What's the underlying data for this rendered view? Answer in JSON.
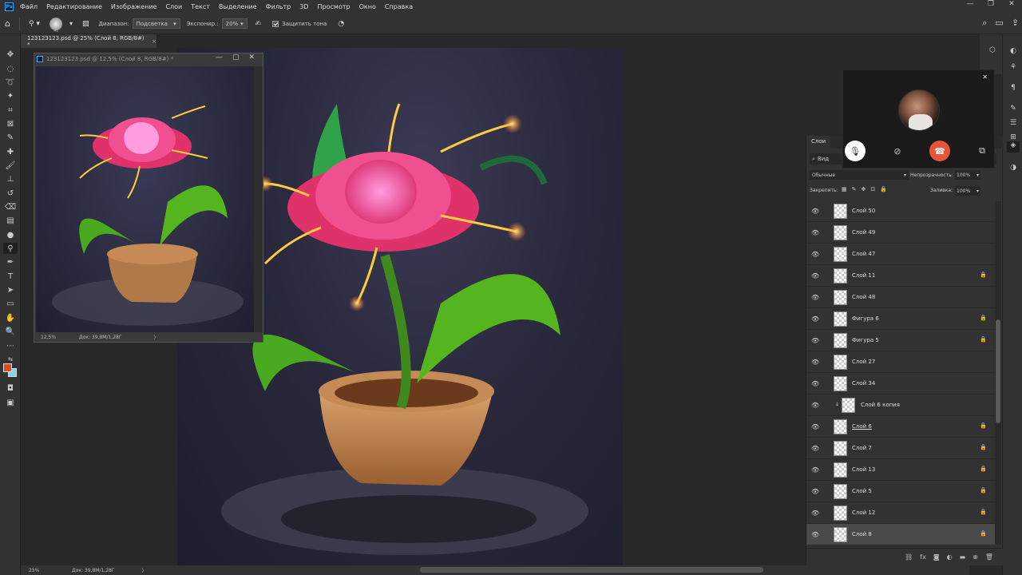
{
  "menu": {
    "items": [
      "Файл",
      "Редактирование",
      "Изображение",
      "Слои",
      "Текст",
      "Выделение",
      "Фильтр",
      "3D",
      "Просмотр",
      "Окно",
      "Справка"
    ]
  },
  "options": {
    "brush_size": "40",
    "range_label": "Диапазон:",
    "range_value": "Подсветка",
    "exposure_label": "Экспонир.:",
    "exposure_value": "20%",
    "protect_label": "Защитить тона"
  },
  "tab": {
    "title": "123123123.psd @ 25% (Слой 8, RGB/8#) *",
    "close": "×"
  },
  "float_window": {
    "title": "123123123.psd @ 12,5% (Слой 8, RGB/8#) *",
    "zoom": "12,5%",
    "doc": "Док: 39,8M/1,28Г"
  },
  "status": {
    "zoom": "25%",
    "doc": "Док: 39,8M/1,28Г"
  },
  "layers_panel": {
    "tab": "Слои",
    "filter": "Вид",
    "blend": "Обычные",
    "opacity_label": "Непрозрачность:",
    "opacity": "100%",
    "lock_label": "Закрепить:",
    "fill_label": "Заливка:",
    "fill": "100%",
    "layers": [
      {
        "name": "Слой 50",
        "locked": false
      },
      {
        "name": "Слой 49",
        "locked": false
      },
      {
        "name": "Слой 47",
        "locked": false
      },
      {
        "name": "Слой 11",
        "locked": true
      },
      {
        "name": "Слой 48",
        "locked": false
      },
      {
        "name": "Фигура 6",
        "locked": true
      },
      {
        "name": "Фигура 5",
        "locked": true
      },
      {
        "name": "Слой 27",
        "locked": false
      },
      {
        "name": "Слой 34",
        "locked": false
      },
      {
        "name": "Слой 6 копия",
        "locked": false
      },
      {
        "name": "Слой 6",
        "locked": true
      },
      {
        "name": "Слой 7",
        "locked": true
      },
      {
        "name": "Слой 13",
        "locked": true
      },
      {
        "name": "Слой 5",
        "locked": true
      },
      {
        "name": "Слой 12",
        "locked": true
      },
      {
        "name": "Слой 8",
        "locked": true
      }
    ]
  },
  "colors": {
    "foreground": "#e24a1b",
    "background": "#7fd6e6",
    "hangup": "#e8533a"
  }
}
